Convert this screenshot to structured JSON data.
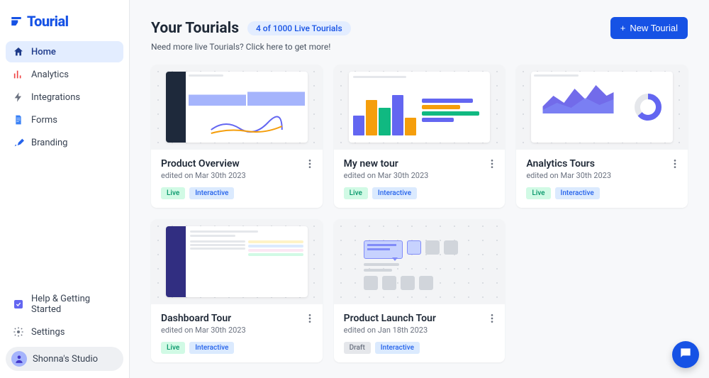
{
  "brand": {
    "name": "Tourial"
  },
  "sidebar": {
    "items": [
      {
        "label": "Home",
        "icon": "home",
        "active": true
      },
      {
        "label": "Analytics",
        "icon": "chart",
        "active": false
      },
      {
        "label": "Integrations",
        "icon": "bolt",
        "active": false
      },
      {
        "label": "Forms",
        "icon": "doc",
        "active": false
      },
      {
        "label": "Branding",
        "icon": "brush",
        "active": false
      }
    ],
    "bottom": [
      {
        "label": "Help & Getting Started",
        "icon": "check-square"
      },
      {
        "label": "Settings",
        "icon": "gear"
      }
    ],
    "workspace": "Shonna's Studio"
  },
  "header": {
    "title": "Your Tourials",
    "count_label": "4 of 1000 Live Tourials",
    "subtext": "Need more live Tourials? Click here to get more!",
    "new_button": "New Tourial"
  },
  "cards": [
    {
      "title": "Product Overview",
      "edited": "edited on Mar 30th 2023",
      "status": "Live",
      "type": "Interactive",
      "thumb": "analytics-dark"
    },
    {
      "title": "My new tour",
      "edited": "edited on Mar 30th 2023",
      "status": "Live",
      "type": "Interactive",
      "thumb": "bars"
    },
    {
      "title": "Analytics Tours",
      "edited": "edited on Mar 30th 2023",
      "status": "Live",
      "type": "Interactive",
      "thumb": "area"
    },
    {
      "title": "Dashboard Tour",
      "edited": "edited on Mar 30th 2023",
      "status": "Live",
      "type": "Interactive",
      "thumb": "list-dark"
    },
    {
      "title": "Product Launch Tour",
      "edited": "edited on Jan 18th 2023",
      "status": "Draft",
      "type": "Interactive",
      "thumb": "placeholder"
    }
  ]
}
